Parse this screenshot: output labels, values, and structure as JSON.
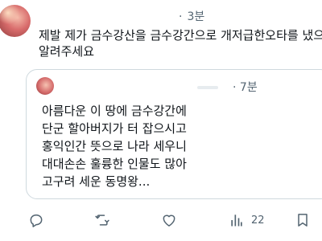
{
  "tweet": {
    "time": "3분",
    "text_lines": [
      "제발 제가 금수강산을 금수강간으로 개저급한오타를 냈으",
      "알려주세요"
    ]
  },
  "quote": {
    "time": "7분",
    "text_lines": [
      "아름다운 이 땅에 금수강간에",
      "단군 할아버지가 터 잡으시고",
      "홍익인간 뜻으로 나라 세우니",
      "대대손손 훌륭한 인물도 많아",
      "고구려 세운 동명왕..."
    ]
  },
  "actions": {
    "reply_icon": "reply-icon",
    "retweet_icon": "retweet-icon",
    "like_icon": "heart-icon",
    "views_icon": "views-icon",
    "views_count": "22",
    "bookmark_icon": "bookmark-icon"
  },
  "colors": {
    "text": "#0f1419",
    "muted": "#536471",
    "border": "#cfd9de"
  }
}
